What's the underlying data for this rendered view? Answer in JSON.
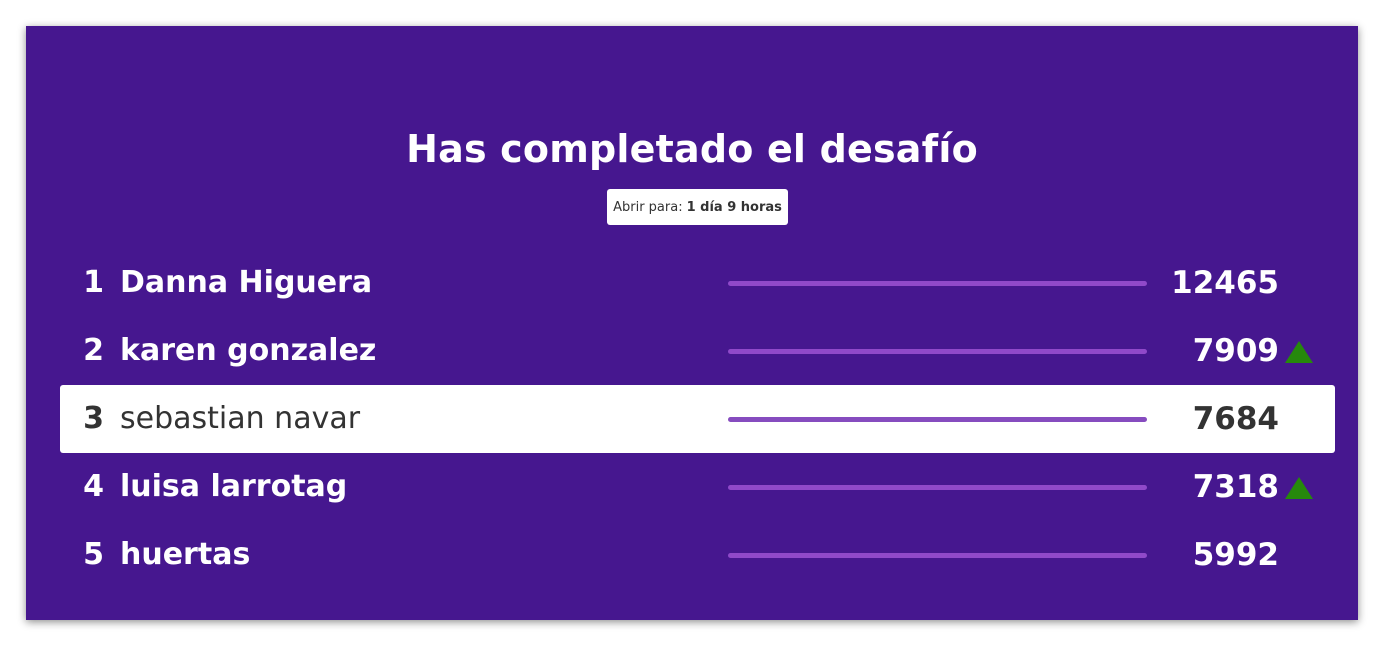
{
  "header": {
    "title": "Has completado el desafío"
  },
  "timer": {
    "label": "Abrir para:",
    "value": "1 día 9 horas"
  },
  "colors": {
    "background": "#46178f",
    "bar": "#9049c9",
    "up_arrow": "#26890c",
    "highlight": "#ffffff"
  },
  "leaderboard": [
    {
      "rank": "1",
      "name": "Danna Higuera",
      "score": "12465",
      "trend": "none",
      "highlighted": false
    },
    {
      "rank": "2",
      "name": "karen gonzalez",
      "score": "7909",
      "trend": "up-arrow-icon",
      "highlighted": false
    },
    {
      "rank": "3",
      "name": "sebastian navar",
      "score": "7684",
      "trend": "none",
      "highlighted": true
    },
    {
      "rank": "4",
      "name": "luisa larrotag",
      "score": "7318",
      "trend": "up-arrow-icon",
      "highlighted": false
    },
    {
      "rank": "5",
      "name": "huertas",
      "score": "5992",
      "trend": "none",
      "highlighted": false
    }
  ]
}
